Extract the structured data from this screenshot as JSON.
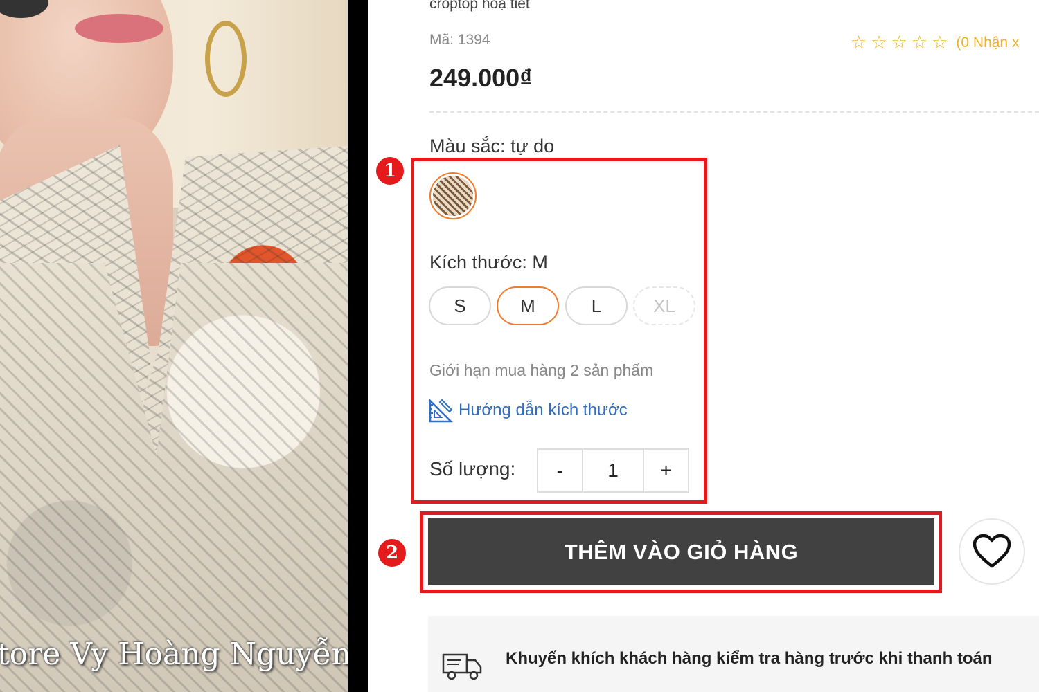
{
  "photo": {
    "watermark": "tore Vy Hoàng Nguyễn"
  },
  "product": {
    "name": "croptop hoạ tiết",
    "sku_label": "Mã:",
    "sku_value": "1394",
    "rating_stars": 0,
    "rating_text": "(0 Nhận x",
    "price": "249.000₫"
  },
  "color": {
    "label": "Màu sắc:",
    "selected": "tự do",
    "swatch_icon": "shirt-thumbnail"
  },
  "size": {
    "label": "Kích thước:",
    "selected": "M",
    "options": [
      {
        "label": "S",
        "state": "normal"
      },
      {
        "label": "M",
        "state": "selected"
      },
      {
        "label": "L",
        "state": "normal"
      },
      {
        "label": "XL",
        "state": "disabled"
      }
    ]
  },
  "limit_note": "Giới hạn mua hàng 2 sản phẩm",
  "size_guide": {
    "label": "Hướng dẫn kích thước",
    "icon": "ruler-icon"
  },
  "quantity": {
    "label": "Số lượng:",
    "minus": "-",
    "value": "1",
    "plus": "+"
  },
  "cart": {
    "add_label": "THÊM VÀO GIỎ HÀNG",
    "wishlist_icon": "heart-icon"
  },
  "promo": {
    "text": "Khuyến khích khách hàng kiểm tra hàng trước khi thanh toán",
    "icon": "delivery-truck-icon"
  },
  "annotations": {
    "badge1": "1",
    "badge2": "2",
    "highlight_color": "#e41a1c"
  },
  "colors": {
    "accent_orange": "#f07b2a",
    "button_dark": "#414141",
    "star_yellow": "#f2b01e",
    "link_blue": "#2f6ec4"
  }
}
